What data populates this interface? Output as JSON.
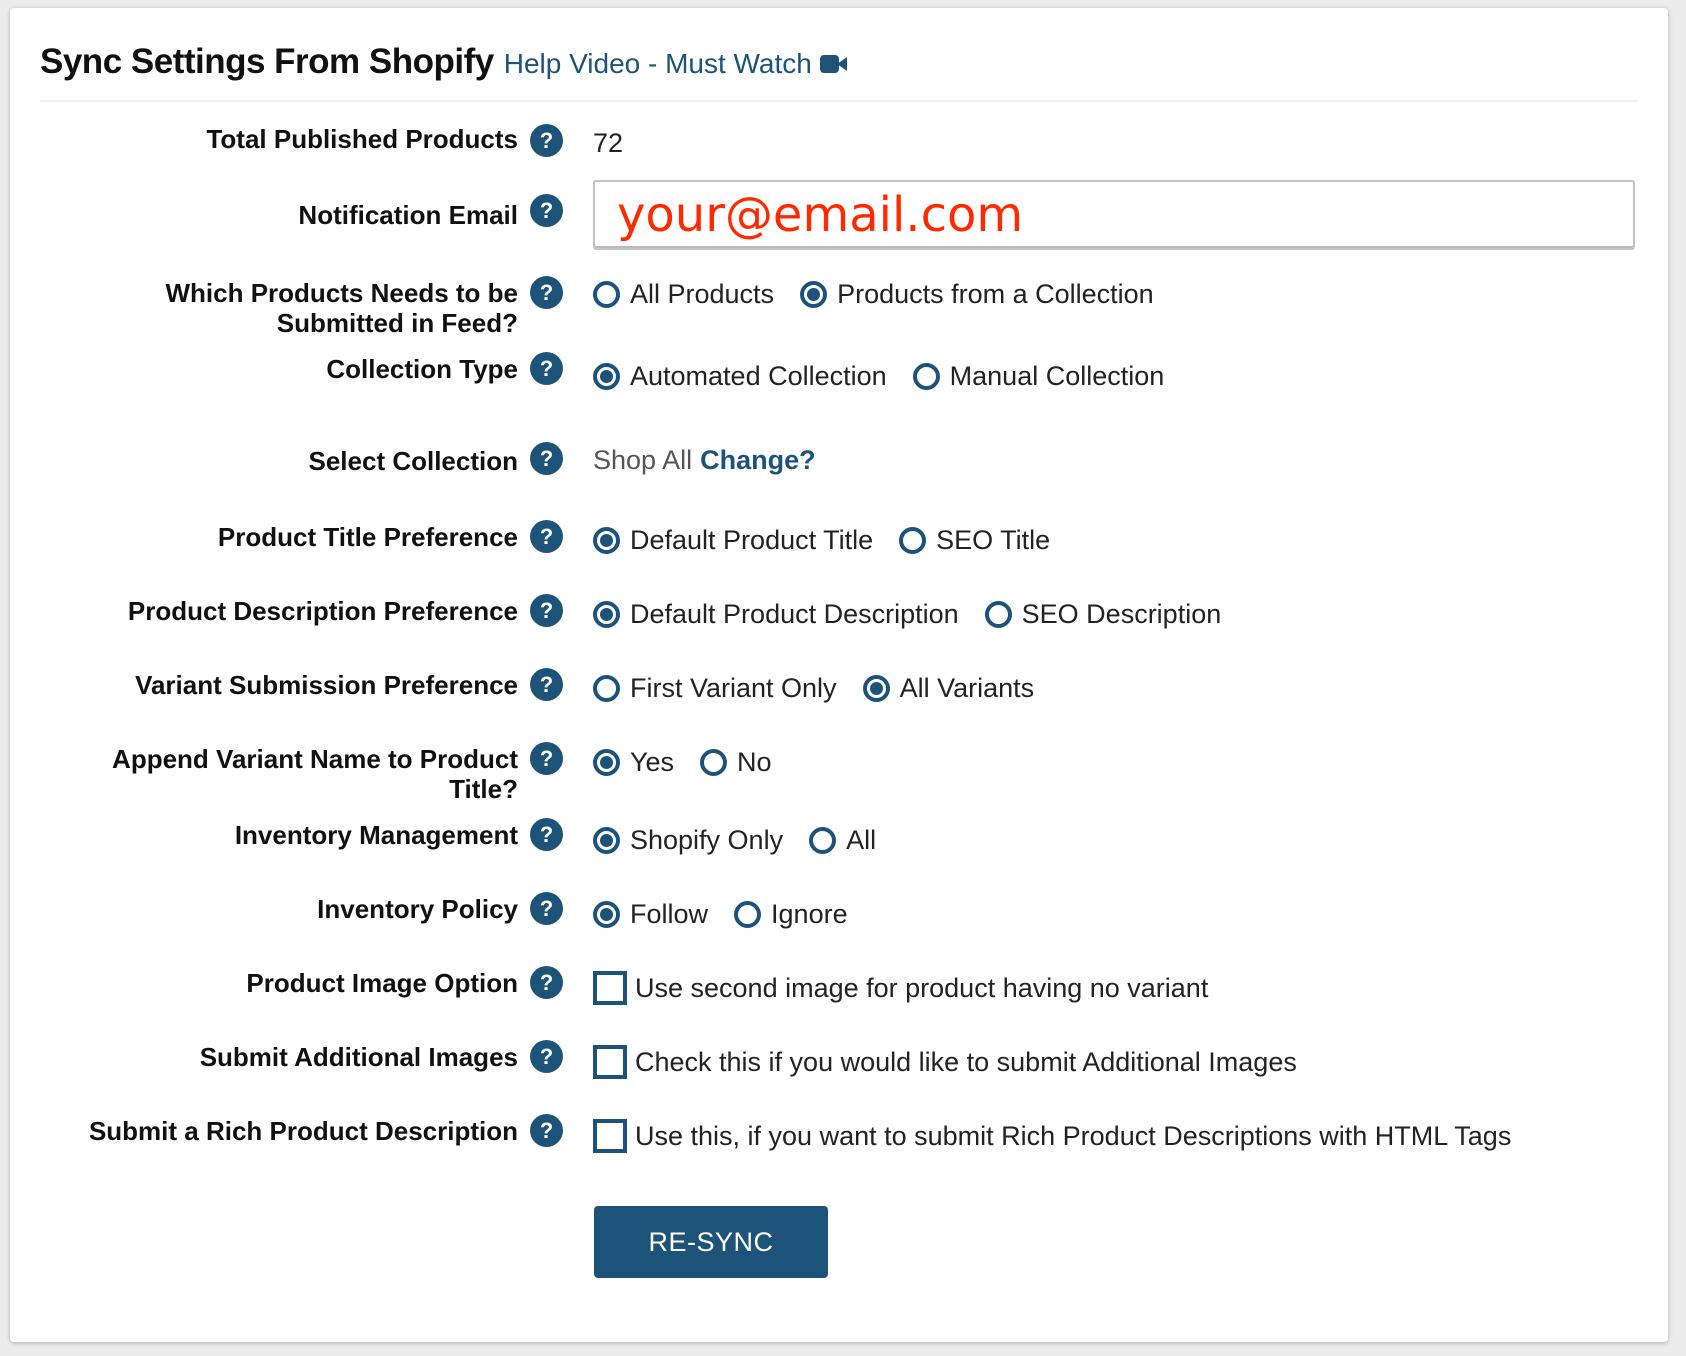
{
  "header": {
    "title": "Sync Settings From Shopify",
    "help_link": "Help Video - Must Watch",
    "help_icon": "video-camera-icon"
  },
  "colors": {
    "accent": "#1d5379",
    "email_text": "#ff2a00",
    "background": "#ececec"
  },
  "fields": {
    "total_products": {
      "label": "Total Published Products",
      "value": "72"
    },
    "notification_email": {
      "label": "Notification Email",
      "value": "your@email.com"
    },
    "which_products": {
      "label_line1": "Which Products Needs to be",
      "label_line2": "Submitted in Feed?",
      "options": [
        {
          "label": "All Products",
          "checked": false
        },
        {
          "label": "Products from a Collection",
          "checked": true
        }
      ]
    },
    "collection_type": {
      "label": "Collection Type",
      "options": [
        {
          "label": "Automated Collection",
          "checked": true
        },
        {
          "label": "Manual Collection",
          "checked": false
        }
      ]
    },
    "select_collection": {
      "label": "Select Collection",
      "value": "Shop All",
      "change_link": "Change?"
    },
    "title_pref": {
      "label": "Product Title Preference",
      "options": [
        {
          "label": "Default Product Title",
          "checked": true
        },
        {
          "label": "SEO Title",
          "checked": false
        }
      ]
    },
    "desc_pref": {
      "label": "Product Description Preference",
      "options": [
        {
          "label": "Default Product Description",
          "checked": true
        },
        {
          "label": "SEO Description",
          "checked": false
        }
      ]
    },
    "variant_pref": {
      "label": "Variant Submission Preference",
      "options": [
        {
          "label": "First Variant Only",
          "checked": false
        },
        {
          "label": "All Variants",
          "checked": true
        }
      ]
    },
    "append_variant": {
      "label_line1": "Append Variant Name to Product",
      "label_line2": "Title?",
      "options": [
        {
          "label": "Yes",
          "checked": true
        },
        {
          "label": "No",
          "checked": false
        }
      ]
    },
    "inventory_mgmt": {
      "label": "Inventory Management",
      "options": [
        {
          "label": "Shopify Only",
          "checked": true
        },
        {
          "label": "All",
          "checked": false
        }
      ]
    },
    "inventory_policy": {
      "label": "Inventory Policy",
      "options": [
        {
          "label": "Follow",
          "checked": true
        },
        {
          "label": "Ignore",
          "checked": false
        }
      ]
    },
    "image_option": {
      "label": "Product Image Option",
      "checkbox_label": "Use second image for product having no variant",
      "checked": false
    },
    "additional_images": {
      "label": "Submit Additional Images",
      "checkbox_label": "Check this if you would like to submit Additional Images",
      "checked": false
    },
    "rich_desc": {
      "label": "Submit a Rich Product Description",
      "checkbox_label": "Use this, if you want to submit Rich Product Descriptions with HTML Tags",
      "checked": false
    }
  },
  "help_icon_glyph": "?",
  "actions": {
    "resync_label": "RE-SYNC"
  }
}
